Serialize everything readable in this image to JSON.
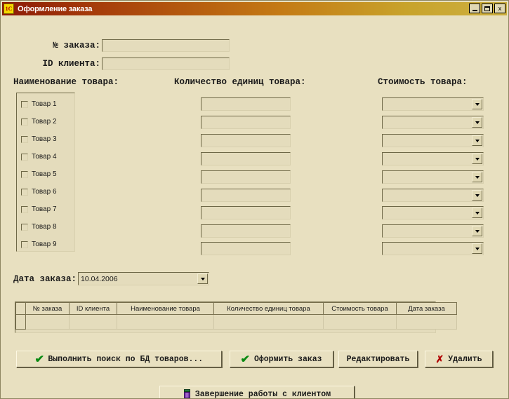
{
  "window": {
    "title": "Оформление заказа",
    "icon": "1c-logo-icon",
    "minimize_label": "_",
    "maximize_label": "□",
    "close_label": "x"
  },
  "form": {
    "order_number": {
      "label": "№ заказа:",
      "value": "",
      "placeholder": ""
    },
    "client_id": {
      "label": "ID клиента:",
      "value": "",
      "placeholder": ""
    },
    "columns": {
      "product_name": "Наименование товара:",
      "quantity": "Количество единиц товара:",
      "cost": "Стоимость товара:"
    },
    "products": [
      {
        "label": "Товар 1",
        "checked": false,
        "quantity": "",
        "cost": ""
      },
      {
        "label": "Товар 2",
        "checked": false,
        "quantity": "",
        "cost": ""
      },
      {
        "label": "Товар 3",
        "checked": false,
        "quantity": "",
        "cost": ""
      },
      {
        "label": "Товар 4",
        "checked": false,
        "quantity": "",
        "cost": ""
      },
      {
        "label": "Товар 5",
        "checked": false,
        "quantity": "",
        "cost": ""
      },
      {
        "label": "Товар 6",
        "checked": false,
        "quantity": "",
        "cost": ""
      },
      {
        "label": "Товар 7",
        "checked": false,
        "quantity": "",
        "cost": ""
      },
      {
        "label": "Товар 8",
        "checked": false,
        "quantity": "",
        "cost": ""
      },
      {
        "label": "Товар 9",
        "checked": false,
        "quantity": "",
        "cost": ""
      }
    ],
    "order_date": {
      "label": "Дата заказа:",
      "value": "10.04.2006"
    }
  },
  "grid": {
    "headers": [
      "№ заказа",
      "ID клиента",
      "Наименование товара",
      "Количество единиц товара",
      "Стоимость товара",
      "Дата заказа"
    ],
    "rows": [
      [
        "",
        "",
        "",
        "",
        "",
        ""
      ]
    ]
  },
  "buttons": {
    "search": {
      "label": "Выполнить поиск по БД товаров...",
      "icon": "green-check-icon"
    },
    "create_order": {
      "label": "Оформить заказ",
      "icon": "green-check-icon"
    },
    "edit": {
      "label": "Редактировать",
      "icon": ""
    },
    "delete": {
      "label": "Удалить",
      "icon": "red-x-icon"
    },
    "finish": {
      "label": "Завершение работы с клиентом",
      "icon": "exit-person-icon"
    }
  },
  "colors": {
    "form_bg": "#e8e0c0",
    "field_bg": "#e4dcbc",
    "title_start": "#8c1a07",
    "title_end": "#cdb040",
    "check_green": "#0a8a12",
    "x_red": "#b00000"
  },
  "glyphs": {
    "check": "✔",
    "cross": "✗"
  }
}
